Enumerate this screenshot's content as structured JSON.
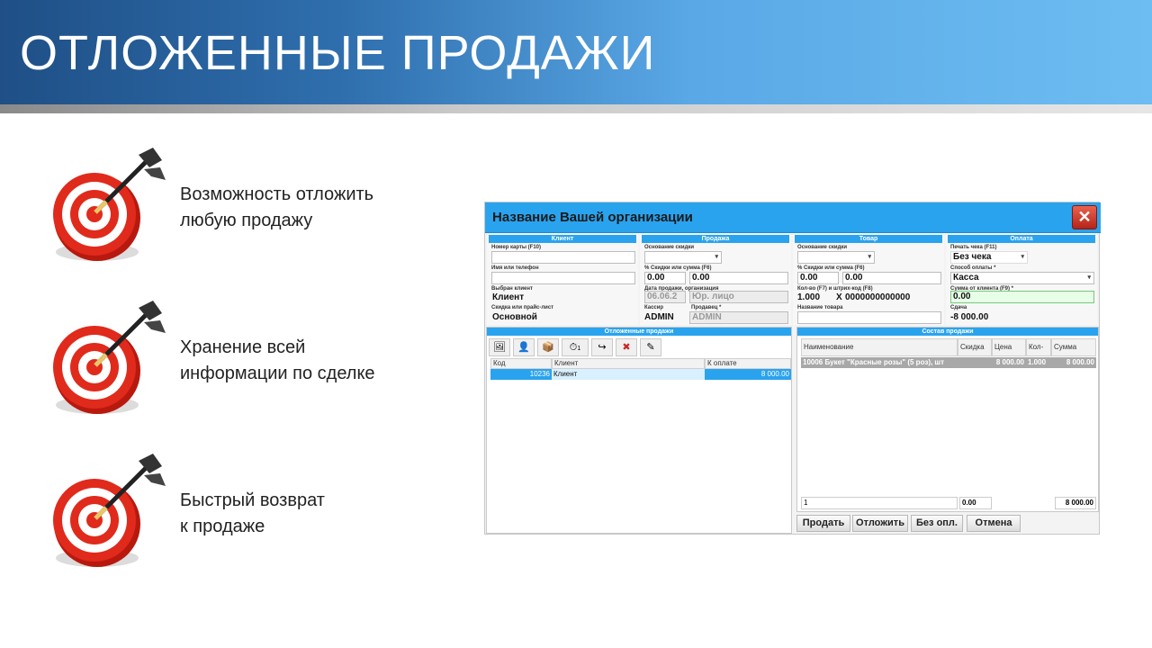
{
  "slide": {
    "title": "ОТЛОЖЕННЫЕ ПРОДАЖИ"
  },
  "bullets": [
    {
      "line1": "Возможность отложить",
      "line2": "любую продажу"
    },
    {
      "line1": "Хранение всей",
      "line2": "информации по сделке"
    },
    {
      "line1": "Быстрый возврат",
      "line2": "к продаже"
    }
  ],
  "app": {
    "title": "Название Вашей организации",
    "close_icon": "✕",
    "client": {
      "header": "Клиент",
      "card_label": "Номер карты (F10)",
      "name_label": "Имя или телефон",
      "chosen_label": "Выбран клиент",
      "chosen_value": "Клиент",
      "discount_label": "Скидка или прайс-лист",
      "discount_value": "Основной"
    },
    "sale": {
      "header": "Продажа",
      "basis_label": "Основание скидки",
      "percent_label": "% Скидки или сумма (F6)",
      "percent_value": "0.00",
      "sum_value": "0.00",
      "date_label": "Дата продажи, организация",
      "date_value": "06.06.2",
      "org_value": "Юр. лицо",
      "cashier_label": "Кассир",
      "cashier_value": "ADMIN",
      "seller_label": "Продавец *",
      "seller_value": "ADMIN"
    },
    "goods": {
      "header": "Товар",
      "basis_label": "Основание скидки",
      "percent_label": "% Скидки или сумма (F6)",
      "percent_value": "0.00",
      "sum_value": "0.00",
      "qty_label": "Кол-во (F7) и штрих-код (F8)",
      "qty_value": "1.000",
      "x_sign": "X",
      "barcode_value": "0000000000000",
      "name_label": "Название товара"
    },
    "payment": {
      "header": "Оплата",
      "print_label": "Печать чека (F11)",
      "print_value": "Без чека",
      "method_label": "Способ оплаты *",
      "method_value": "Касса",
      "client_sum_label": "Сумма от клиента (F9) *",
      "client_sum_value": "0.00",
      "change_label": "Сдача",
      "change_value": "-8 000.00"
    },
    "deferred": {
      "header": "Отложенные продажи",
      "badge": "1",
      "columns": [
        "Код",
        "Клиент",
        "К оплате"
      ],
      "rows": [
        {
          "code": "10236",
          "client": "Клиент",
          "amount": "8 000.00"
        }
      ]
    },
    "composition": {
      "header": "Состав продажи",
      "columns": [
        "Наименование",
        "Скидка",
        "Цена",
        "Кол-во",
        "Сумма"
      ],
      "rows": [
        {
          "name": "10006 Букет \"Красные розы\" (5 роз), шт",
          "discount": "",
          "price": "8 000.00",
          "qty": "1.000",
          "sum": "8 000.00"
        }
      ],
      "footer": {
        "count": "1",
        "discount": "0.00",
        "sum": "8 000.00"
      }
    },
    "buttons": {
      "sell": "Продать",
      "defer": "Отложить",
      "no_pay": "Без опл.",
      "cancel": "Отмена"
    },
    "toolbar_icons": [
      "picture-icon",
      "user-icon",
      "box-icon",
      "clock-icon",
      "return-arrow-icon",
      "delete-icon",
      "edit-icon"
    ]
  }
}
